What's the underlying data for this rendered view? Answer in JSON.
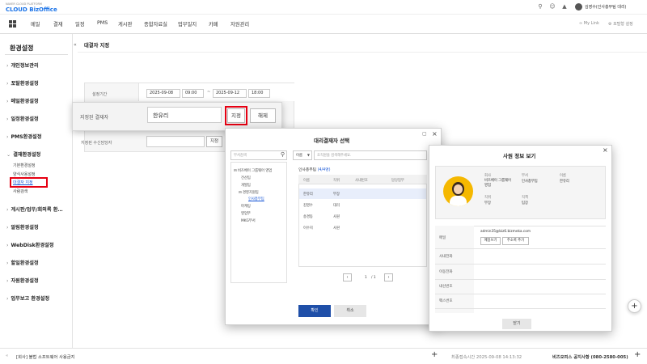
{
  "app": {
    "logo_main": "CLOUD BizOffice",
    "logo_tag": "NAVER CLOUD PLATFORM"
  },
  "user": {
    "name": "김영수(인사총무팀 대리)"
  },
  "nav": {
    "items": [
      "메일",
      "결재",
      "일정",
      "PMS",
      "게시판",
      "종합자료실",
      "업무일지",
      "카페",
      "자원관리"
    ],
    "my_link": "My Link",
    "portal_settings": "포털형 설정"
  },
  "sidebar": {
    "title": "환경설정",
    "items": [
      "개인정보관리",
      "포탈환경설정",
      "메일환경설정",
      "일정환경설정",
      "PMS환경설정",
      "결재환경설정",
      "게시판/업무/회의록 환…",
      "알림환경설정",
      "WebDisk환경설정",
      "할일환경설정",
      "자원환경설정",
      "업무보고 환경설정"
    ],
    "approval_subitems": [
      "기본환경설정",
      "양식사용설정",
      "대결자 지정",
      "사람검색"
    ]
  },
  "main": {
    "title": "대결자 지정",
    "period_label": "설정기간",
    "start_date": "2025-09-08",
    "start_time": "09:00",
    "tilde": "~",
    "end_date": "2025-09-12",
    "end_time": "18:00",
    "receiver_label": "지정된 수신담당자",
    "assign_label": "지정"
  },
  "designated": {
    "label": "지정된 결재자",
    "value": "한유리",
    "assign_button": "지정",
    "release_button": "해제"
  },
  "proxy_dialog": {
    "title": "대리결재자 선택",
    "search_placeholder": "부서검색",
    "filter_select": "이름",
    "filter_placeholder": "조직원을 검색해주세요.",
    "tree": [
      "비즈베이 그룹웨어 영업",
      "전산팀",
      "개발팀",
      "경영지원팀",
      "인사총무팀",
      "마케팅",
      "영업부",
      "MKG부서"
    ],
    "dept_name": "인사총무팀",
    "dept_count": "(4/4명)",
    "columns": [
      "이름",
      "직위",
      "사내번호",
      "담당업무"
    ],
    "rows": [
      [
        "한유리",
        "부장"
      ],
      [
        "김영수",
        "대리"
      ],
      [
        "송경동",
        "사원"
      ],
      [
        "이수지",
        "사원"
      ]
    ],
    "page": "1",
    "page_total": "/ 1",
    "confirm": "확인",
    "cancel": "취소"
  },
  "employee": {
    "title": "사원 정보 보기",
    "company_label": "회사",
    "company_value": "비즈베이 그룹웨어 영업",
    "dept_label": "부서",
    "dept_value": "인사총무팀",
    "name_label": "이름",
    "name_value": "한유리",
    "position_label": "직위",
    "position_value": "부장",
    "rank_label": "직책",
    "rank_value": "팀장",
    "email_label": "메일",
    "email_value": "admin35@biz6.bizmeka.com",
    "send_mail": "메일쓰기",
    "add_contact": "주소록 추가",
    "fields": [
      "사내전화",
      "이동전화",
      "내선번호",
      "팩스번호"
    ],
    "close": "닫기"
  },
  "footer": {
    "notice_left": "[회사] 불법 소프트웨어 사용금지",
    "last_login": "최종접속시간 2025-09-08 14:13:32",
    "notice_right": "비즈오피스 공지사항 (080-2580-005)"
  },
  "colors": {
    "accent": "#1a58d6",
    "highlight": "#e60012",
    "confirm_button": "#1f4fa8"
  }
}
